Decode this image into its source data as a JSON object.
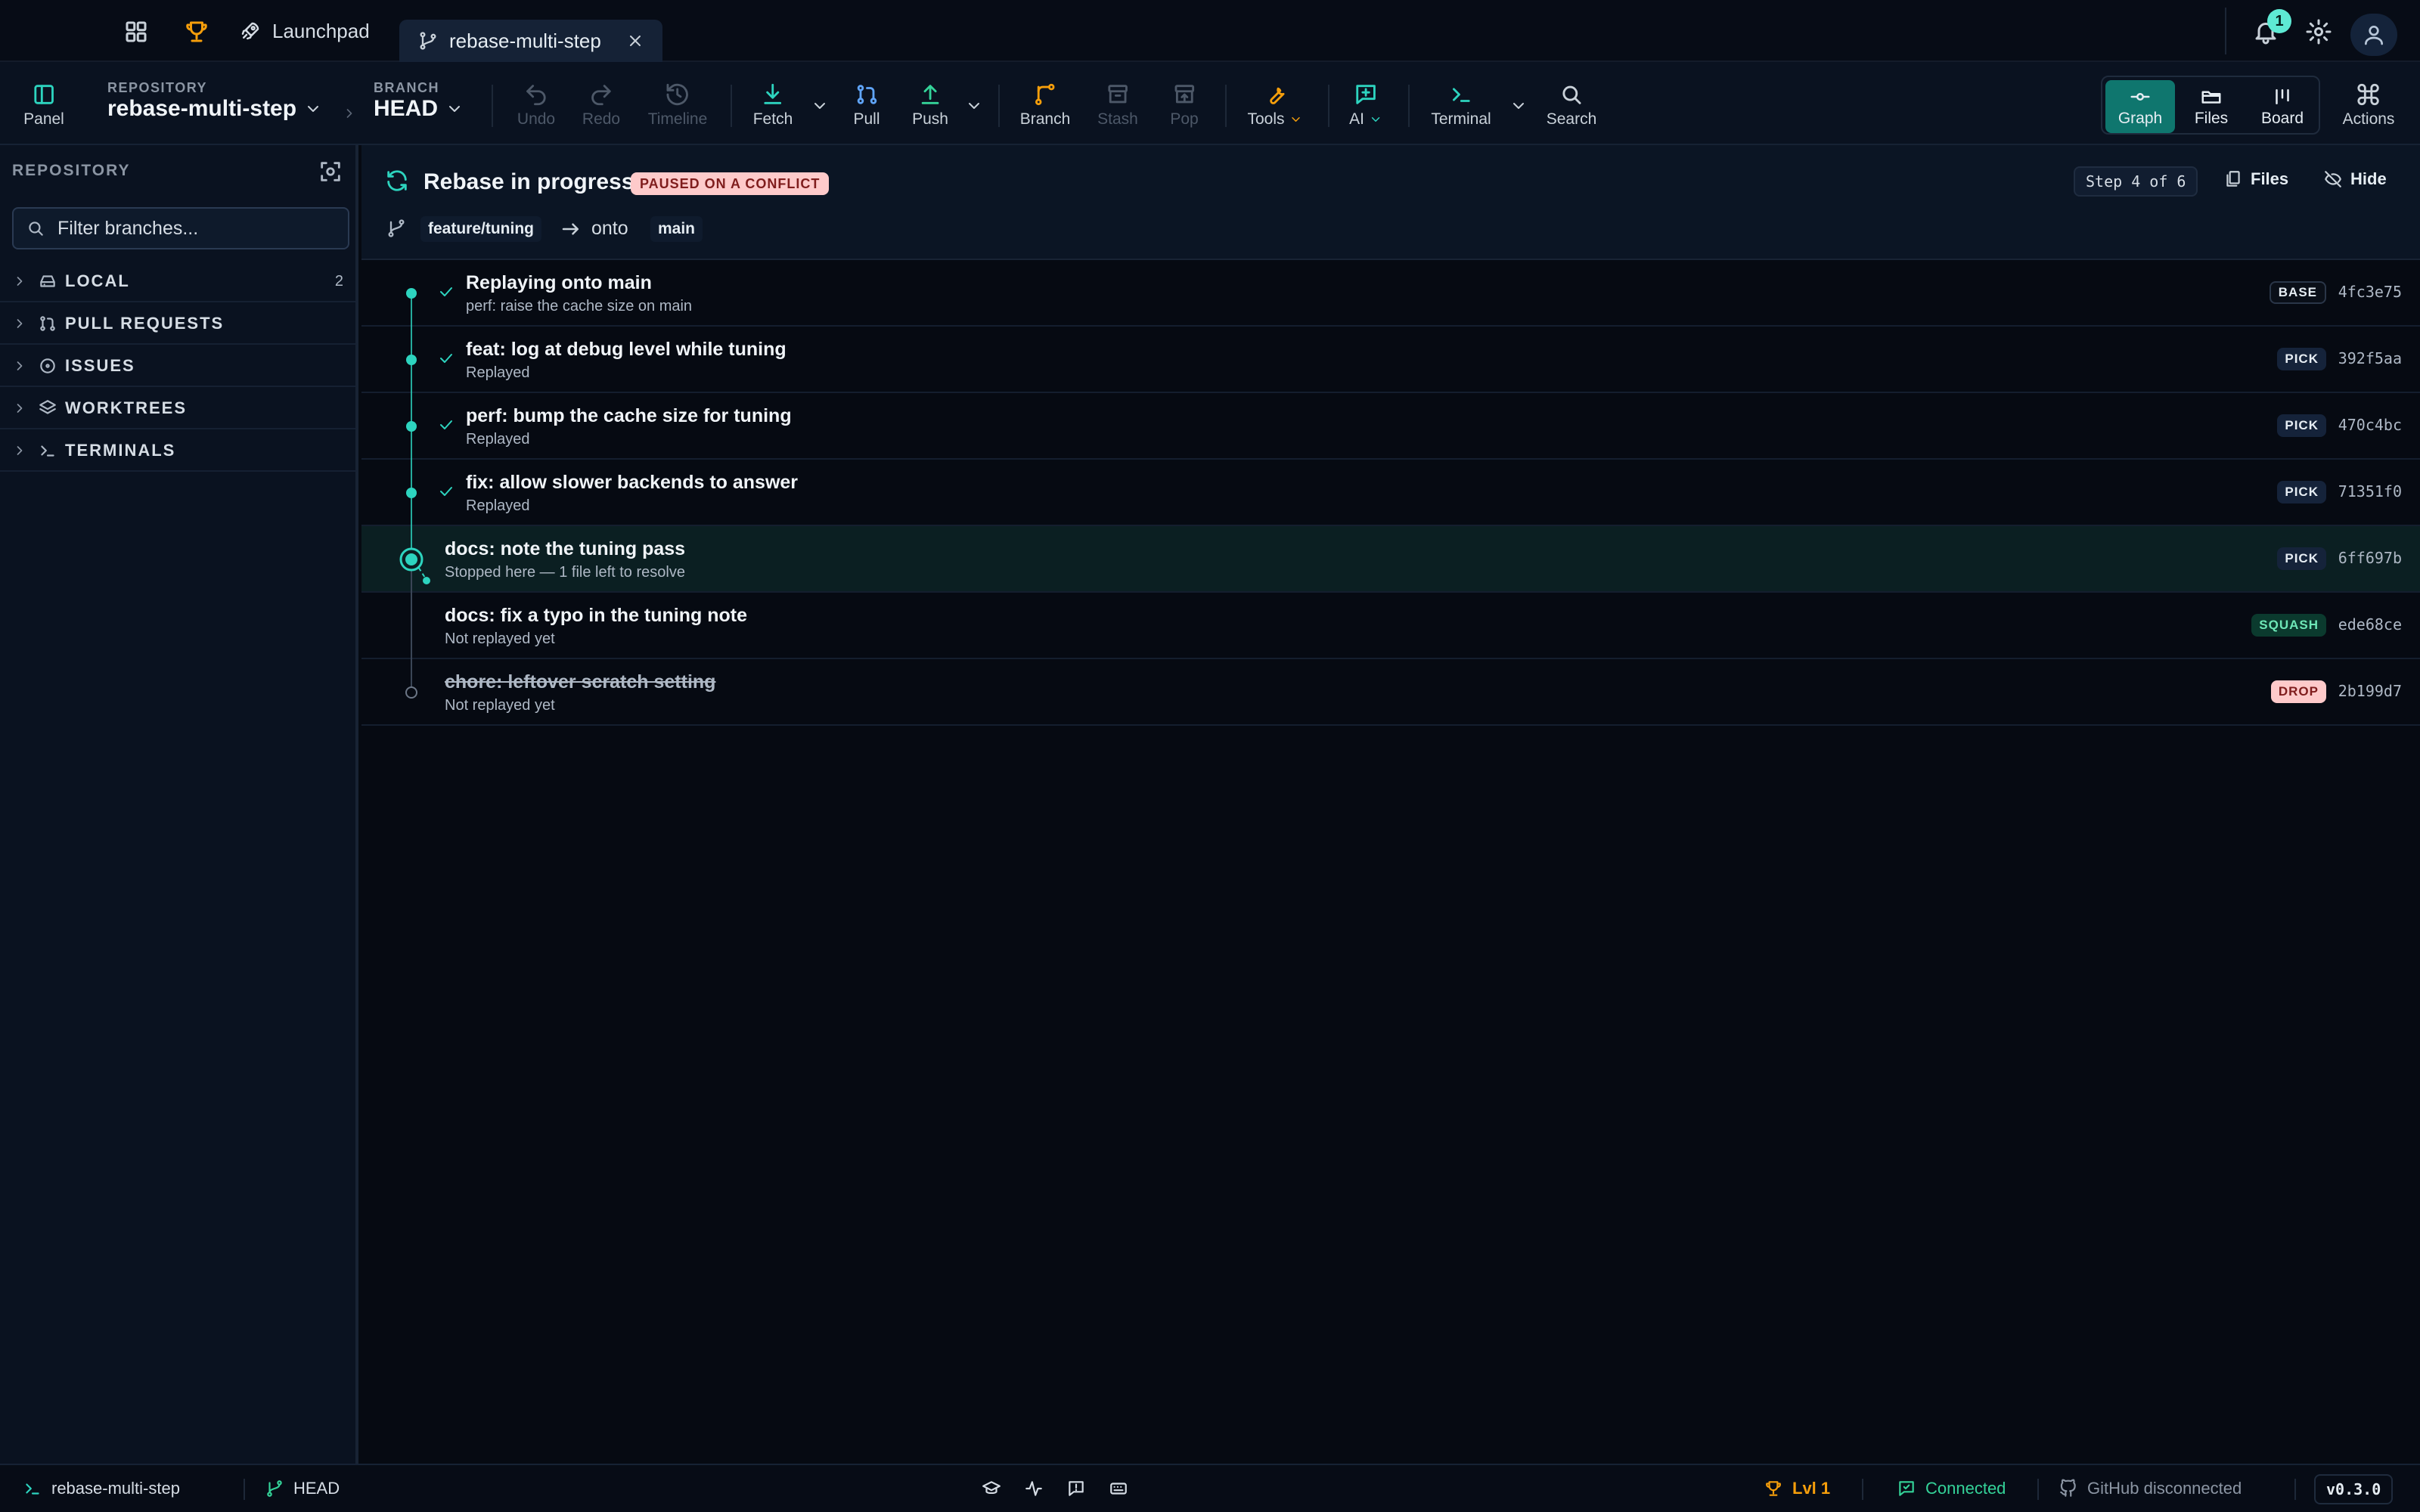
{
  "titlebar": {
    "tabs": [
      {
        "label": "Launchpad"
      },
      {
        "label": "rebase-multi-step"
      }
    ],
    "notifications_count": "1"
  },
  "toolbar": {
    "panel_label": "Panel",
    "repository_caption": "REPOSITORY",
    "repository_name": "rebase-multi-step",
    "branch_caption": "BRANCH",
    "branch_name": "HEAD",
    "undo": "Undo",
    "redo": "Redo",
    "timeline": "Timeline",
    "fetch": "Fetch",
    "pull": "Pull",
    "push": "Push",
    "branch": "Branch",
    "stash": "Stash",
    "pop": "Pop",
    "tools": "Tools",
    "ai": "AI",
    "terminal": "Terminal",
    "search": "Search",
    "views": {
      "graph": "Graph",
      "files": "Files",
      "board": "Board"
    },
    "actions": "Actions"
  },
  "sidebar": {
    "title": "REPOSITORY",
    "filter_placeholder": "Filter branches...",
    "sections": [
      {
        "label": "LOCAL",
        "count": "2"
      },
      {
        "label": "PULL REQUESTS"
      },
      {
        "label": "ISSUES"
      },
      {
        "label": "WORKTREES"
      },
      {
        "label": "TERMINALS"
      }
    ]
  },
  "rebase": {
    "title": "Rebase in progress",
    "badge": "PAUSED ON A CONFLICT",
    "step": "Step 4 of 6",
    "files_label": "Files",
    "hide_label": "Hide",
    "source_branch": "feature/tuning",
    "onto_label": "onto",
    "target_branch": "main"
  },
  "commits": [
    {
      "message": "Replaying onto main",
      "sub": "perf: raise the cache size on main",
      "tag": "BASE",
      "hash": "4fc3e75"
    },
    {
      "message": "feat: log at debug level while tuning",
      "sub": "Replayed",
      "tag": "PICK",
      "hash": "392f5aa"
    },
    {
      "message": "perf: bump the cache size for tuning",
      "sub": "Replayed",
      "tag": "PICK",
      "hash": "470c4bc"
    },
    {
      "message": "fix: allow slower backends to answer",
      "sub": "Replayed",
      "tag": "PICK",
      "hash": "71351f0"
    },
    {
      "message": "docs: note the tuning pass",
      "sub": "Stopped here — 1 file left to resolve",
      "tag": "PICK",
      "hash": "6ff697b"
    },
    {
      "message": "docs: fix a typo in the tuning note",
      "sub": "Not replayed yet",
      "tag": "SQUASH",
      "hash": "ede68ce"
    },
    {
      "message": "chore: leftover scratch setting",
      "sub": "Not replayed yet",
      "tag": "DROP",
      "hash": "2b199d7"
    }
  ],
  "statusbar": {
    "terminal_repo": "rebase-multi-step",
    "branch": "HEAD",
    "level": "Lvl 1",
    "connection": "Connected",
    "github": "GitHub disconnected",
    "version": "v0.3.0"
  },
  "colors": {
    "accent": "#2dd4bf",
    "active_view": "#0f766e",
    "conflict_badge": "#fecaca",
    "level": "#f59e0b",
    "connected": "#34d399"
  },
  "icons": {
    "titlebar": [
      "grid-icon",
      "trophy-icon",
      "rocket-icon",
      "git-branch-icon",
      "close-icon",
      "bell-icon",
      "gear-icon",
      "user-icon"
    ]
  }
}
